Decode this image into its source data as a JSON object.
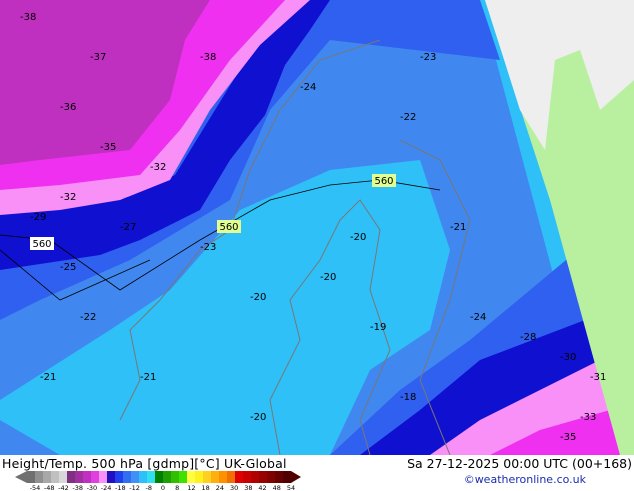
{
  "title": "Height/Temp. 500 hPa [gdmp][°C] UK-Global",
  "valid_time": "Sa 27-12-2025 00:00 UTC (00+168)",
  "credit": "©weatheronline.co.uk",
  "map": {
    "contour_labels": [
      "560",
      "560",
      "560",
      "560"
    ],
    "sample_temps": [
      "-38",
      "-37",
      "-36",
      "-35",
      "-32",
      "-29",
      "-27",
      "-25",
      "-23",
      "-22",
      "-21",
      "-20",
      "-19",
      "-18",
      "-24",
      "-28",
      "-30",
      "-31",
      "-33",
      "-35"
    ],
    "colors": {
      "land": "#b8f0a0",
      "outside": "#eeeeee",
      "very_cold": "#c030c0",
      "cold_magenta": "#f030f0",
      "pink": "#f890f8",
      "dark_blue": "#1010d0",
      "blue": "#3060f0",
      "mid_blue": "#4088f0",
      "light_blue": "#30c0f8"
    }
  },
  "legend": {
    "ticks": [
      "-54",
      "-48",
      "-42",
      "-38",
      "-30",
      "-24",
      "-18",
      "-12",
      "-8",
      "0",
      "8",
      "12",
      "18",
      "24",
      "30",
      "38",
      "42",
      "48",
      "54"
    ],
    "colors": [
      "#707070",
      "#909090",
      "#a8a8a8",
      "#c0c0c0",
      "#d8d8d8",
      "#803080",
      "#a030a0",
      "#c030c0",
      "#e040e0",
      "#f890f8",
      "#2010c0",
      "#2040f0",
      "#3070f0",
      "#4090f8",
      "#30c0f8",
      "#30e0f0",
      "#008000",
      "#20a000",
      "#30c000",
      "#40e000",
      "#ffff40",
      "#fff020",
      "#ffd020",
      "#ffb010",
      "#ff9000",
      "#f07000",
      "#e00000",
      "#c80000",
      "#b00000",
      "#980000",
      "#800000",
      "#680000",
      "#500000"
    ]
  }
}
